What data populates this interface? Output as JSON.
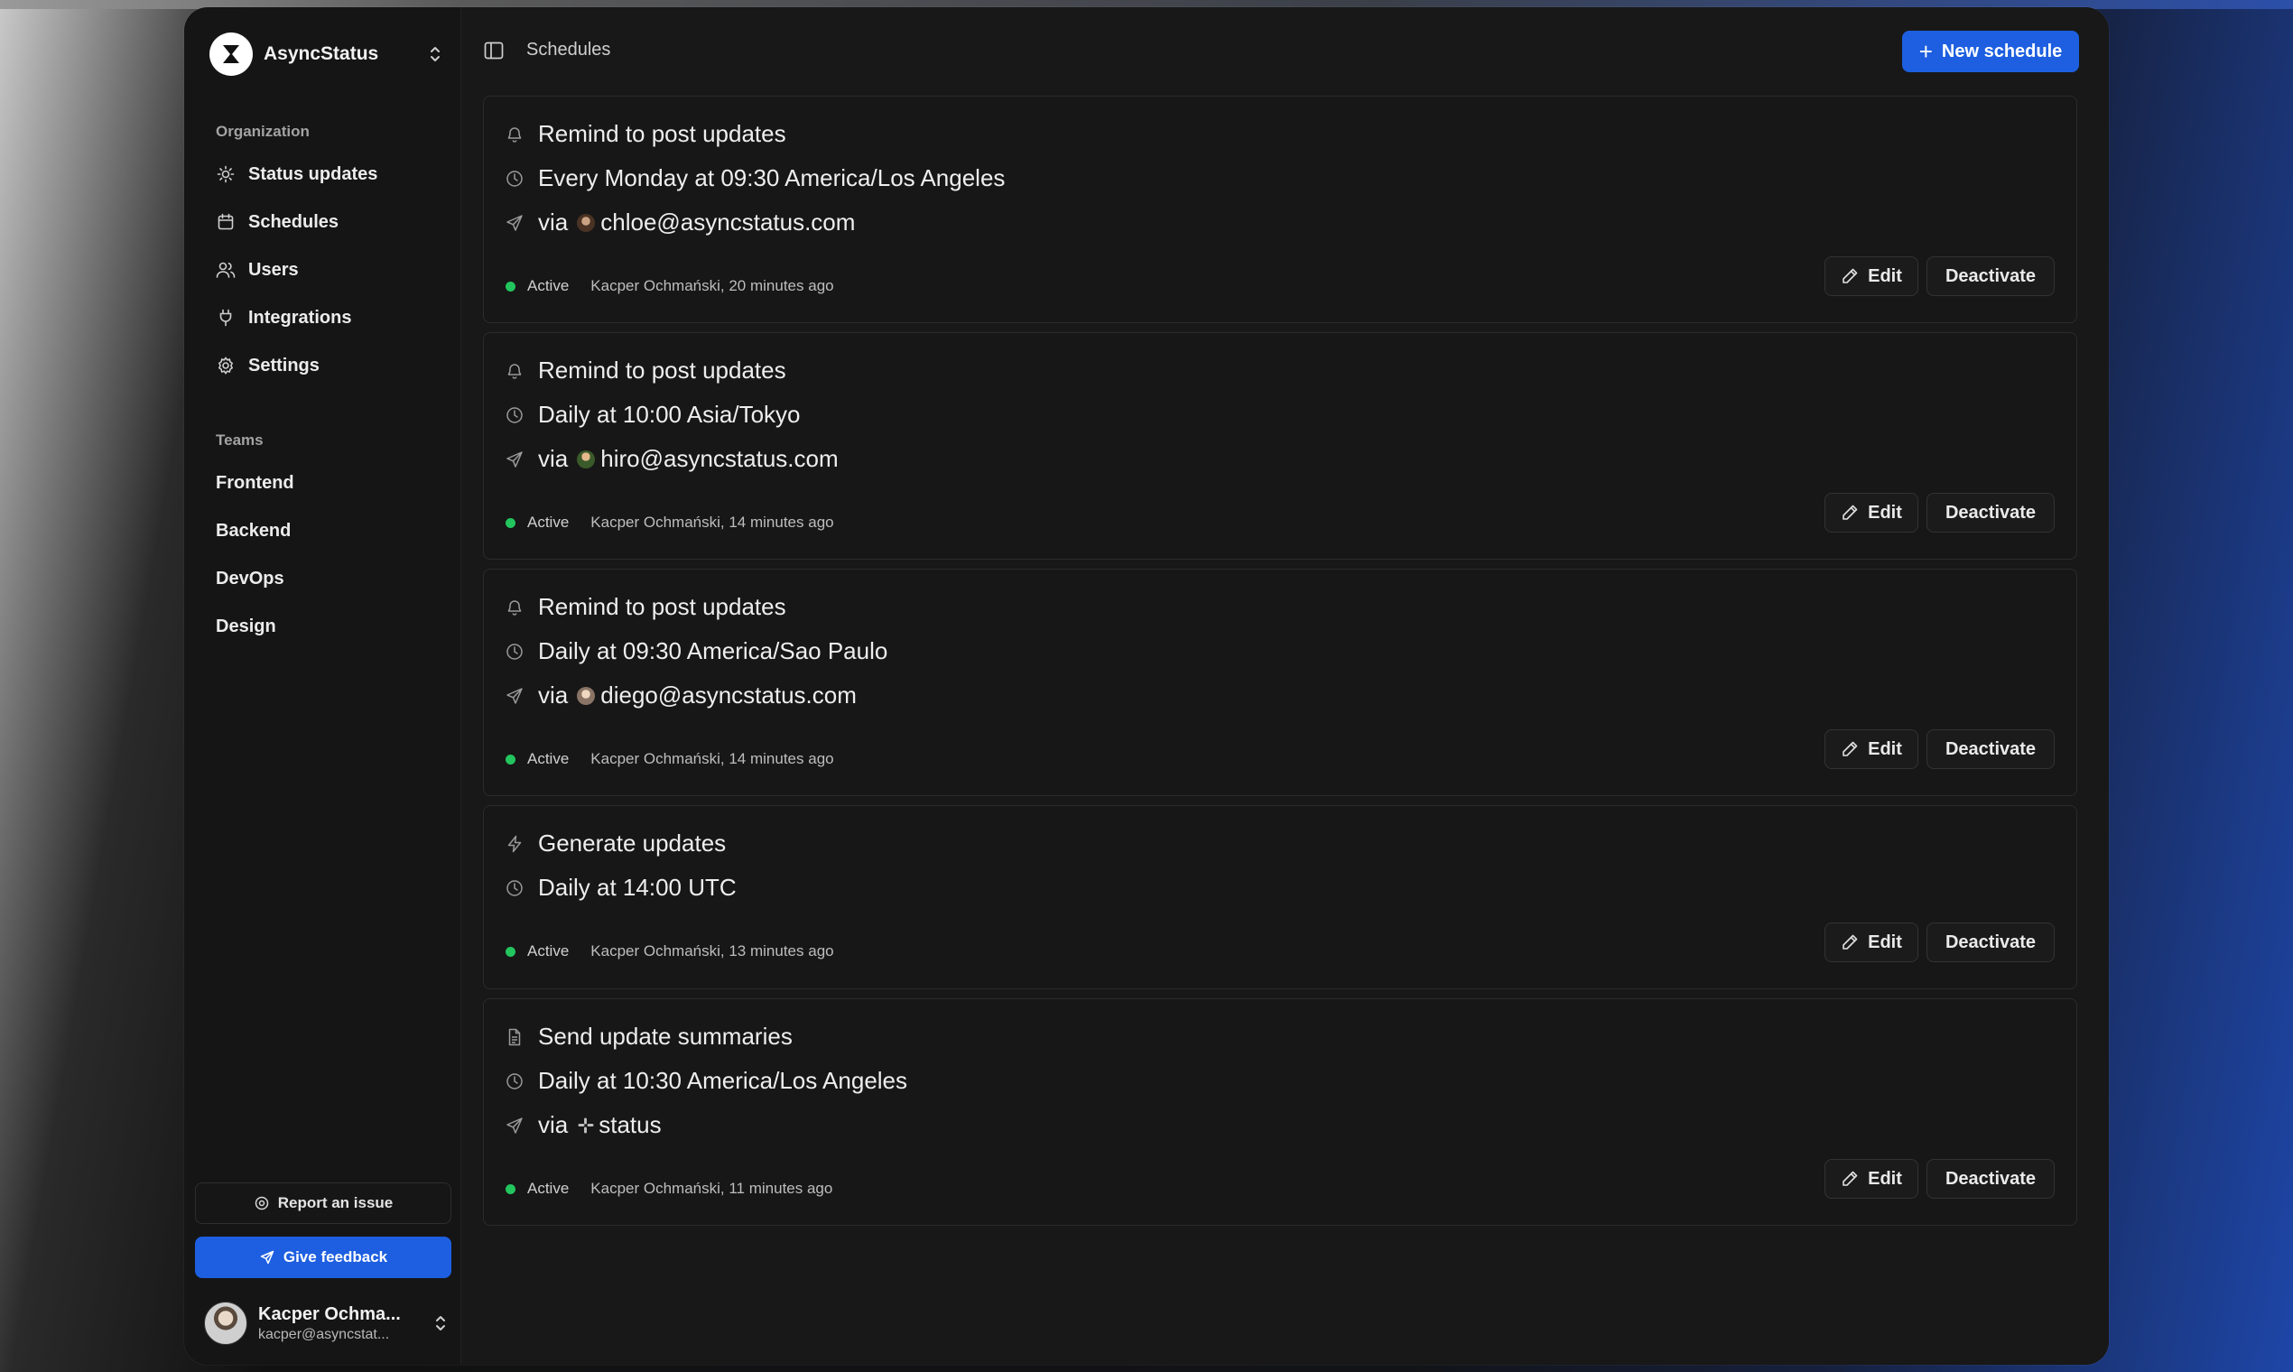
{
  "app": {
    "org_name": "AsyncStatus"
  },
  "sidebar": {
    "organization_label": "Organization",
    "items": [
      {
        "label": "Status updates",
        "icon": "sun-icon"
      },
      {
        "label": "Schedules",
        "icon": "calendar-icon"
      },
      {
        "label": "Users",
        "icon": "users-icon"
      },
      {
        "label": "Integrations",
        "icon": "plug-icon"
      },
      {
        "label": "Settings",
        "icon": "gear-icon"
      }
    ],
    "teams_label": "Teams",
    "teams": [
      "Frontend",
      "Backend",
      "DevOps",
      "Design"
    ],
    "report_issue": "Report an issue",
    "give_feedback": "Give feedback",
    "user": {
      "name": "Kacper Ochma...",
      "email": "kacper@asyncstat..."
    }
  },
  "header": {
    "breadcrumb": "Schedules",
    "new_schedule": "New schedule"
  },
  "schedules": [
    {
      "title": "Remind to post updates",
      "title_icon": "bell-icon",
      "timing": "Every Monday at 09:30 America/Los Angeles",
      "via_prefix": "via",
      "via": "chloe@asyncstatus.com",
      "status": "Active",
      "meta": "Kacper Ochmański, 20 minutes ago",
      "edit": "Edit",
      "deactivate": "Deactivate"
    },
    {
      "title": "Remind to post updates",
      "title_icon": "bell-icon",
      "timing": "Daily at 10:00 Asia/Tokyo",
      "via_prefix": "via",
      "via": "hiro@asyncstatus.com",
      "status": "Active",
      "meta": "Kacper Ochmański, 14 minutes ago",
      "edit": "Edit",
      "deactivate": "Deactivate"
    },
    {
      "title": "Remind to post updates",
      "title_icon": "bell-icon",
      "timing": "Daily at 09:30 America/Sao Paulo",
      "via_prefix": "via",
      "via": "diego@asyncstatus.com",
      "status": "Active",
      "meta": "Kacper Ochmański, 14 minutes ago",
      "edit": "Edit",
      "deactivate": "Deactivate"
    },
    {
      "title": "Generate updates",
      "title_icon": "zap-icon",
      "timing": "Daily at 14:00 UTC",
      "status": "Active",
      "meta": "Kacper Ochmański, 13 minutes ago",
      "edit": "Edit",
      "deactivate": "Deactivate"
    },
    {
      "title": "Send update summaries",
      "title_icon": "document-icon",
      "timing": "Daily at 10:30 America/Los Angeles",
      "via_prefix": "via",
      "via": "status",
      "status": "Active",
      "meta": "Kacper Ochmański, 11 minutes ago",
      "edit": "Edit",
      "deactivate": "Deactivate"
    }
  ],
  "colors": {
    "accent": "#1d5fe0",
    "active_dot": "#22c55e",
    "background": "#181818"
  }
}
